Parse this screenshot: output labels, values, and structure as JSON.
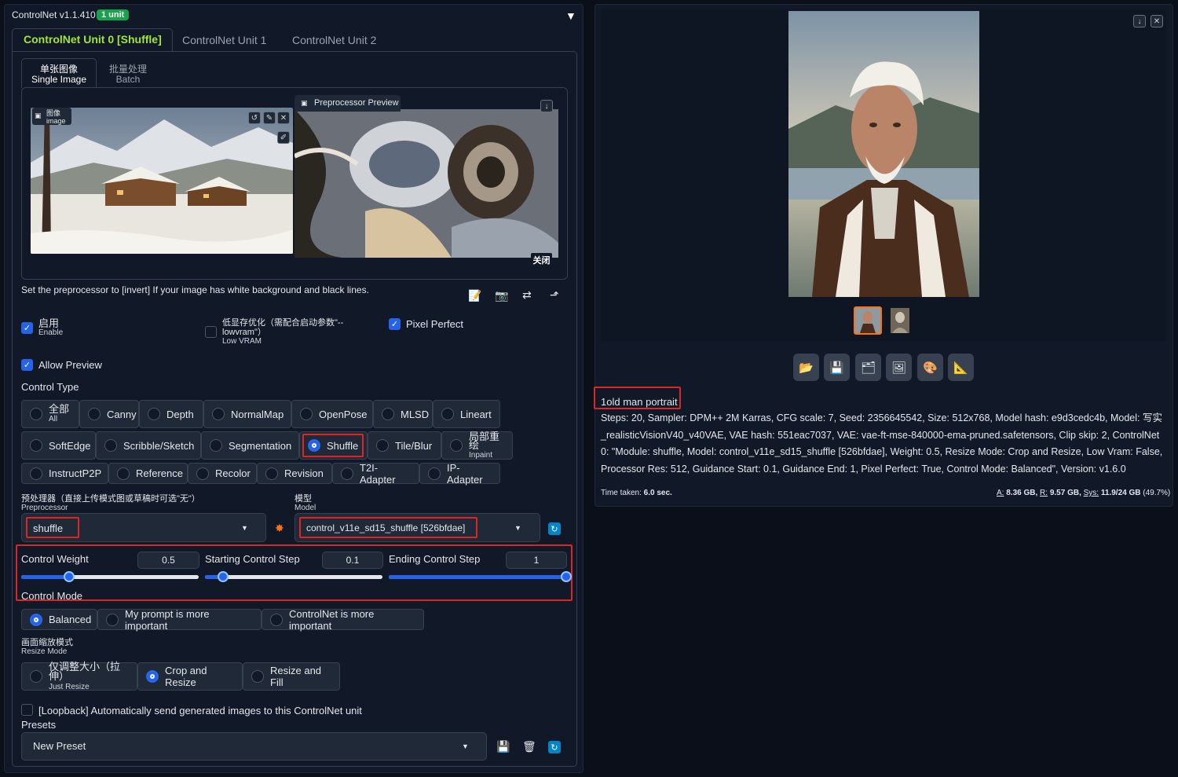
{
  "header": {
    "title": "ControlNet v1.1.410",
    "badge": "1 unit",
    "collapse_icon": "▼"
  },
  "unit_tabs": [
    "ControlNet Unit 0 [Shuffle]",
    "ControlNet Unit 1",
    "ControlNet Unit 2"
  ],
  "image_tabs": [
    {
      "cn": "单张图像",
      "en": "Single Image"
    },
    {
      "cn": "批量处理",
      "en": "Batch"
    }
  ],
  "image_label": {
    "cn": "图像",
    "en": "image"
  },
  "preview_label": "Preprocessor Preview",
  "close_label": "关闭",
  "hint": "Set the preprocessor to [invert] If your image has white background and black lines.",
  "enable": {
    "cn": "启用",
    "en": "Enable"
  },
  "lowvram": {
    "cn": "低显存优化（需配合启动参数\"--lowvram\"）",
    "en": "Low VRAM"
  },
  "pixel_perfect": "Pixel Perfect",
  "allow_preview": "Allow Preview",
  "control_type_label": "Control Type",
  "control_types_row1": [
    {
      "label": "全部",
      "sub": "All"
    },
    {
      "label": "Canny"
    },
    {
      "label": "Depth"
    },
    {
      "label": "NormalMap"
    },
    {
      "label": "OpenPose"
    },
    {
      "label": "MLSD"
    },
    {
      "label": "Lineart"
    }
  ],
  "control_types_row2": [
    {
      "label": "SoftEdge"
    },
    {
      "label": "Scribble/Sketch"
    },
    {
      "label": "Segmentation"
    },
    {
      "label": "Shuffle"
    },
    {
      "label": "Tile/Blur"
    },
    {
      "label": "局部重绘",
      "sub": "Inpaint"
    }
  ],
  "control_types_row3": [
    {
      "label": "InstructP2P"
    },
    {
      "label": "Reference"
    },
    {
      "label": "Recolor"
    },
    {
      "label": "Revision"
    },
    {
      "label": "T2I-Adapter"
    },
    {
      "label": "IP-Adapter"
    }
  ],
  "preprocessor": {
    "label_cn": "预处理器（直接上传模式图或草稿时可选\"无\"）",
    "label_en": "Preprocessor",
    "value": "shuffle"
  },
  "model": {
    "label_cn": "模型",
    "label_en": "Model",
    "value": "control_v11e_sd15_shuffle [526bfdae]"
  },
  "control_weight": {
    "label": "Control Weight",
    "value": "0.5",
    "fraction": 0.27
  },
  "starting_step": {
    "label": "Starting Control Step",
    "value": "0.1",
    "fraction": 0.1
  },
  "ending_step": {
    "label": "Ending Control Step",
    "value": "1",
    "fraction": 1.0
  },
  "control_mode_label": "Control Mode",
  "control_modes": [
    "Balanced",
    "My prompt is more important",
    "ControlNet is more important"
  ],
  "resize_mode": {
    "label_cn": "画面缩放模式",
    "label_en": "Resize Mode"
  },
  "resize_modes": [
    {
      "label": "仅调整大小（拉伸）",
      "sub": "Just Resize"
    },
    {
      "label": "Crop and Resize"
    },
    {
      "label": "Resize and Fill"
    }
  ],
  "loopback": "[Loopback] Automatically send generated images to this ControlNet unit",
  "presets_label": "Presets",
  "preset_value": "New Preset",
  "output": {
    "prompt": "1old man portrait",
    "params": "Steps: 20, Sampler: DPM++ 2M Karras, CFG scale: 7, Seed: 2356645542, Size: 512x768, Model hash: e9d3cedc4b, Model: 写实_realisticVisionV40_v40VAE, VAE hash: 551eac7037, VAE: vae-ft-mse-840000-ema-pruned.safetensors, Clip skip: 2, ControlNet 0: \"Module: shuffle, Model: control_v11e_sd15_shuffle [526bfdae], Weight: 0.5, Resize Mode: Crop and Resize, Low Vram: False, Processor Res: 512, Guidance Start: 0.1, Guidance End: 1, Pixel Perfect: True, Control Mode: Balanced\", Version: v1.6.0",
    "time_label": "Time taken:",
    "time_value": "6.0 sec.",
    "vram_a_label": "A:",
    "vram_a": "8.36 GB,",
    "vram_r_label": "R:",
    "vram_r": "9.57 GB,",
    "vram_sys_label": "Sys:",
    "vram_sys": "11.9/24 GB",
    "vram_pct": "(49.7%)"
  },
  "colors": {
    "accent": "#2563eb",
    "tab_active": "#a3e635",
    "highlight": "#dc2626",
    "badge": "#16a34a"
  }
}
